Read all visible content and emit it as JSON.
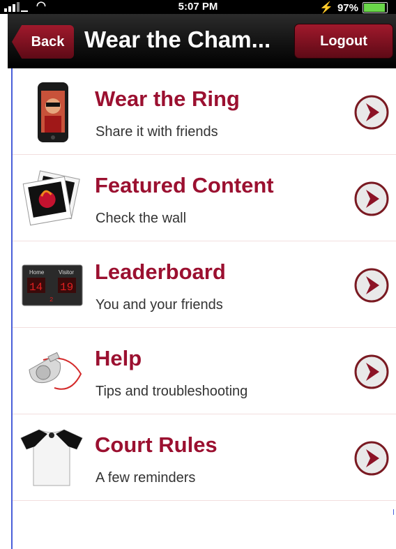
{
  "status_bar": {
    "time": "5:07 PM",
    "battery": "97%",
    "battery_level": 0.97,
    "icons": [
      "signal-icon",
      "wifi-icon",
      "charging-icon",
      "battery-icon"
    ]
  },
  "navbar": {
    "back_label": "Back",
    "title": "Wear the Cham...",
    "logout_label": "Logout"
  },
  "menu": {
    "items": [
      {
        "title": "Wear the Ring",
        "subtitle": "Share it with friends",
        "icon": "phone-icon"
      },
      {
        "title": "Featured Content",
        "subtitle": "Check the wall",
        "icon": "photos-icon"
      },
      {
        "title": "Leaderboard",
        "subtitle": "You and your friends",
        "icon": "scoreboard-icon",
        "scoreboard": {
          "home_label": "Home",
          "visitor_label": "Visitor",
          "home_score": "14",
          "visitor_score": "19",
          "period": "2"
        }
      },
      {
        "title": "Help",
        "subtitle": "Tips and troubleshooting",
        "icon": "whistle-icon"
      },
      {
        "title": "Court Rules",
        "subtitle": "A few reminders",
        "icon": "referee-shirt-icon"
      }
    ]
  },
  "colors": {
    "accent": "#9b1030",
    "navbar": "#121212",
    "button": "#8c1326",
    "divider": "#f2dede"
  }
}
